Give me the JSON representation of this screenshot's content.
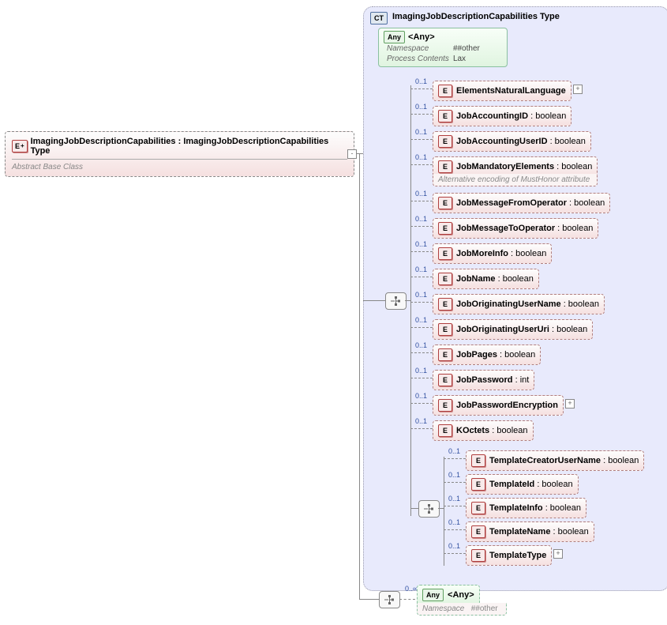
{
  "root": {
    "badge": "E",
    "title": "ImagingJobDescriptionCapabilities : ImagingJobDescriptionCapabilities Type",
    "note": "Abstract Base Class"
  },
  "ct": {
    "badge": "CT",
    "title": "ImagingJobDescriptionCapabilities Type"
  },
  "any_top": {
    "badge": "Any",
    "label": "<Any>",
    "ns_k": "Namespace",
    "ns_v": "##other",
    "pc_k": "Process Contents",
    "pc_v": "Lax"
  },
  "occur_01": "0..1",
  "occur_0s": "0..∞",
  "children": [
    {
      "label": "ElementsNaturalLanguage",
      "type": "",
      "expand": true
    },
    {
      "label": "JobAccountingID",
      "type": "boolean"
    },
    {
      "label": "JobAccountingUserID",
      "type": "boolean"
    },
    {
      "label": "JobMandatoryElements",
      "type": "boolean",
      "note": "Alternative encoding of MustHonor attribute"
    },
    {
      "label": "JobMessageFromOperator",
      "type": "boolean"
    },
    {
      "label": "JobMessageToOperator",
      "type": "boolean"
    },
    {
      "label": "JobMoreInfo",
      "type": "boolean"
    },
    {
      "label": "JobName",
      "type": "boolean"
    },
    {
      "label": "JobOriginatingUserName",
      "type": "boolean"
    },
    {
      "label": "JobOriginatingUserUri",
      "type": "boolean"
    },
    {
      "label": "JobPages",
      "type": "boolean"
    },
    {
      "label": "JobPassword",
      "type": "int"
    },
    {
      "label": "JobPasswordEncryption",
      "type": "",
      "expand": true
    },
    {
      "label": "KOctets ",
      "type": "boolean"
    }
  ],
  "nested": [
    {
      "label": "TemplateCreatorUserName",
      "type": "boolean"
    },
    {
      "label": "TemplateId",
      "type": "boolean"
    },
    {
      "label": "TemplateInfo",
      "type": "boolean"
    },
    {
      "label": "TemplateName",
      "type": "boolean"
    },
    {
      "label": "TemplateType",
      "type": "",
      "expand": true
    }
  ],
  "any_bottom": {
    "badge": "Any",
    "label": "<Any>",
    "ns_k": "Namespace",
    "ns_v": "##other"
  }
}
